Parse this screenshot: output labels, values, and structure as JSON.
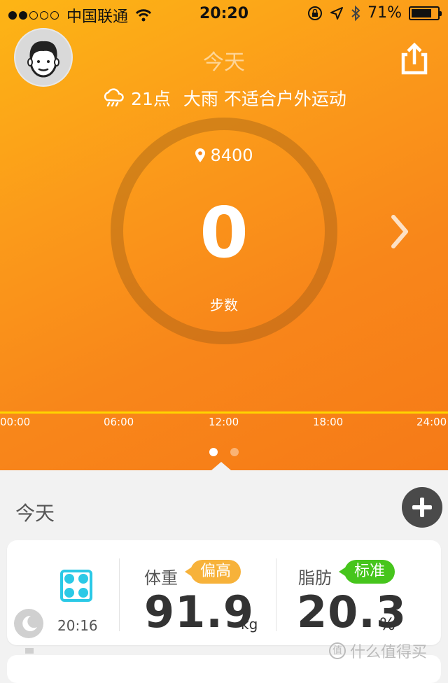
{
  "status_bar": {
    "carrier": "中国联通",
    "time": "20:20",
    "battery": "71%"
  },
  "header": {
    "title": "今天"
  },
  "weather": {
    "time": "21点",
    "condition": "大雨",
    "advice": "不适合户外运动"
  },
  "steps": {
    "goal": "8400",
    "value": "0",
    "label": "步数"
  },
  "timeline": {
    "ticks": [
      "00:00",
      "06:00",
      "12:00",
      "18:00",
      "24:00"
    ]
  },
  "pager": {
    "count": 2,
    "active": 0
  },
  "section": {
    "title": "今天"
  },
  "weight_card": {
    "time": "20:16",
    "weight": {
      "label": "体重",
      "status": "偏高",
      "value": "91.9",
      "unit": "kg"
    },
    "fat": {
      "label": "脂肪",
      "status": "标准",
      "value": "20.3",
      "unit": "%"
    }
  },
  "watermark": {
    "text": "什么值得买",
    "glyph": "值"
  },
  "colors": {
    "accent_orange": "#f8861a",
    "status_high": "#f7b23a",
    "status_normal": "#46c51c",
    "scale_icon": "#2bc9e6"
  }
}
